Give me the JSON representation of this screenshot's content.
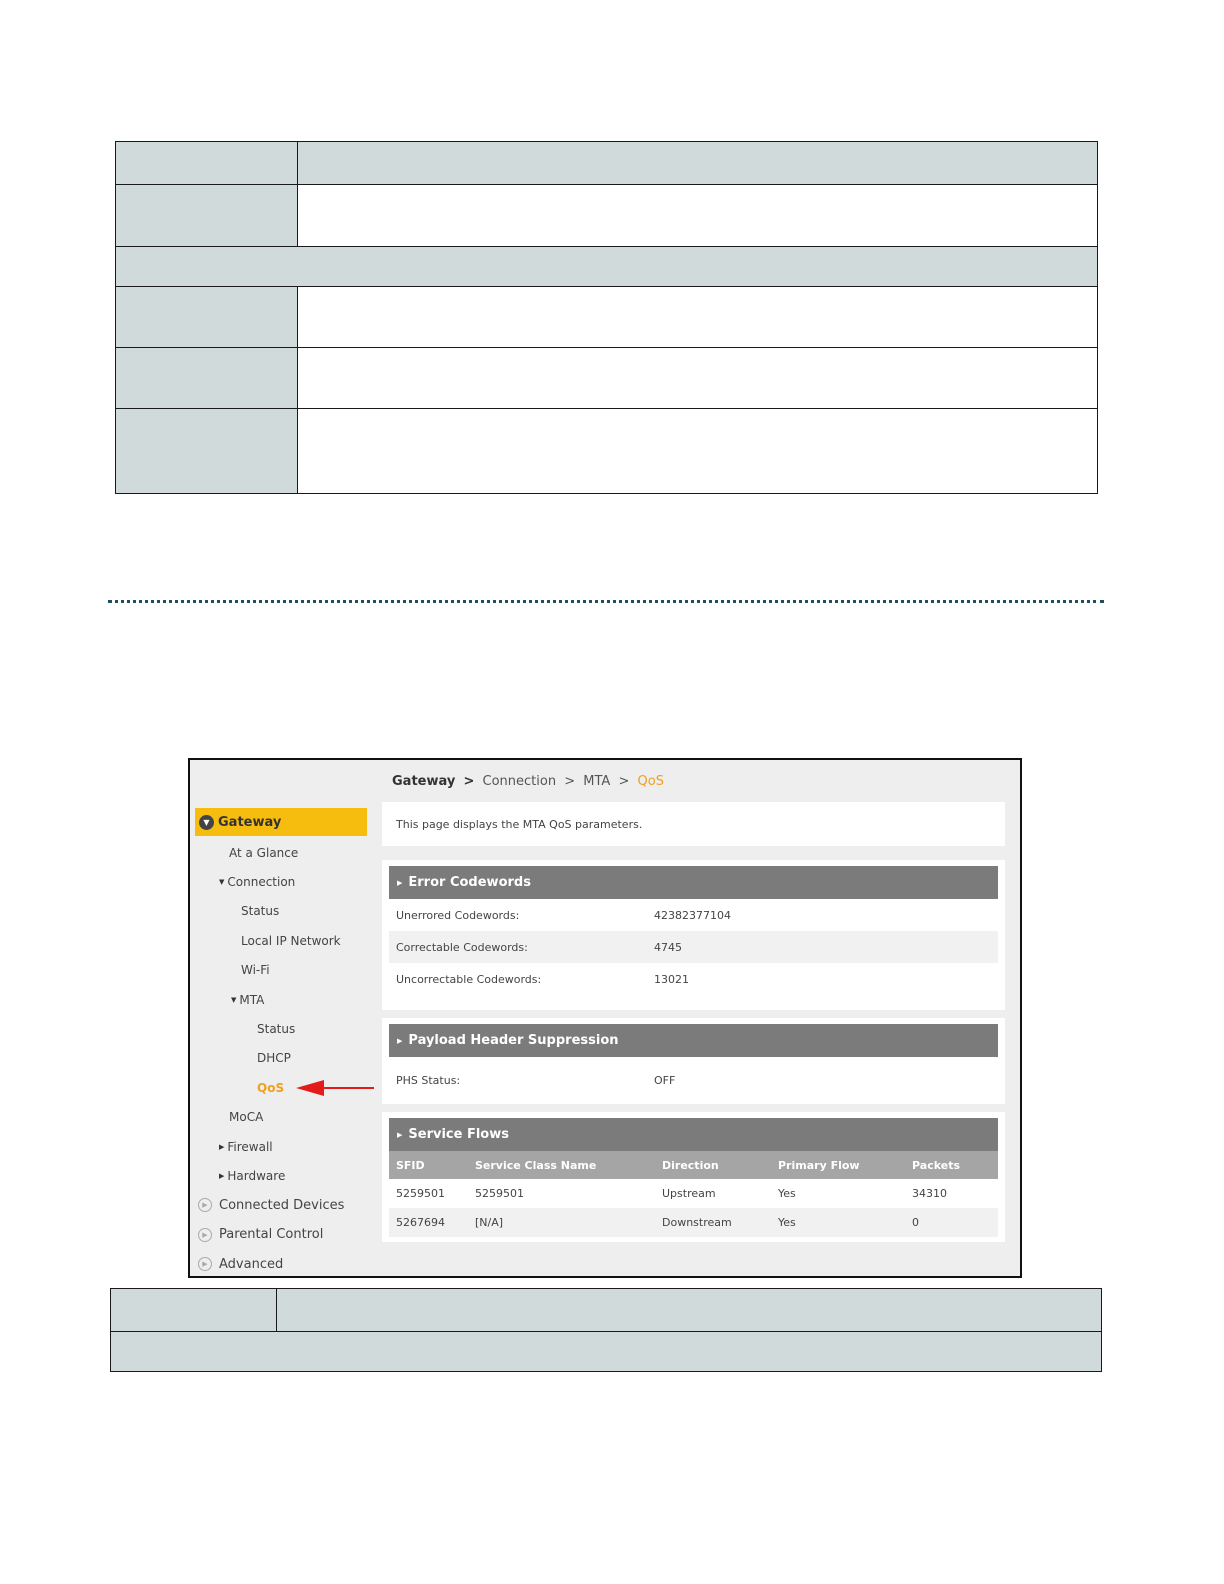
{
  "breadcrumb": {
    "root": "Gateway",
    "sep": ">",
    "items": [
      "Connection",
      "MTA"
    ],
    "current": "QoS"
  },
  "sidebar": {
    "gateway": "Gateway",
    "at_a_glance": "At a Glance",
    "connection": "Connection",
    "connection_items": [
      "Status",
      "Local IP Network",
      "Wi-Fi"
    ],
    "mta": "MTA",
    "mta_items": [
      "Status",
      "DHCP",
      "QoS"
    ],
    "moca": "MoCA",
    "firewall": "Firewall",
    "hardware": "Hardware",
    "connected_devices": "Connected Devices",
    "parental_control": "Parental Control",
    "advanced": "Advanced"
  },
  "intro": "This page displays the MTA QoS parameters.",
  "error_codewords": {
    "title": "Error Codewords",
    "rows": [
      {
        "label": "Unerrored Codewords:",
        "value": "42382377104"
      },
      {
        "label": "Correctable Codewords:",
        "value": "4745"
      },
      {
        "label": "Uncorrectable Codewords:",
        "value": "13021"
      }
    ]
  },
  "phs": {
    "title": "Payload Header Suppression",
    "label": "PHS Status:",
    "value": "OFF"
  },
  "service_flows": {
    "title": "Service Flows",
    "columns": [
      "SFID",
      "Service Class Name",
      "Direction",
      "Primary Flow",
      "Packets"
    ],
    "rows": [
      [
        "5259501",
        "5259501",
        "Upstream",
        "Yes",
        "34310"
      ],
      [
        "5267694",
        "[N/A]",
        "Downstream",
        "Yes",
        "0"
      ]
    ]
  },
  "colors": {
    "accent": "#f7bd0e",
    "current": "#f0a020",
    "header": "#7b7b7b",
    "table_label": "#d0dadb",
    "arrow": "#e31b1b"
  }
}
